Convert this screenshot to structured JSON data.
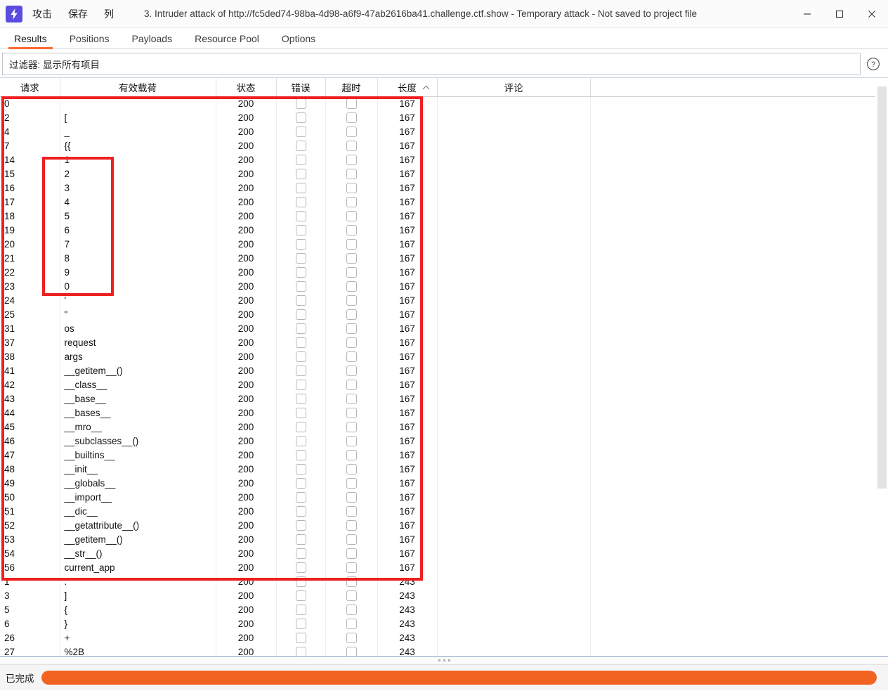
{
  "window": {
    "title": "3. Intruder attack of http://fc5ded74-98ba-4d98-a6f9-47ab2616ba41.challenge.ctf.show - Temporary attack - Not saved to project file",
    "logo_icon": "burp-lightning-icon",
    "minimize_icon": "minimize-icon",
    "maximize_icon": "maximize-icon",
    "close_icon": "close-icon"
  },
  "menu": {
    "attack": "攻击",
    "save": "保存",
    "columns": "列"
  },
  "tabs": [
    {
      "label": "Results",
      "active": true
    },
    {
      "label": "Positions",
      "active": false
    },
    {
      "label": "Payloads",
      "active": false
    },
    {
      "label": "Resource Pool",
      "active": false
    },
    {
      "label": "Options",
      "active": false
    }
  ],
  "filter": {
    "text": "过滤器: 显示所有项目",
    "help_icon": "question-mark-circle-icon"
  },
  "table": {
    "columns": [
      "请求",
      "有效载荷",
      "状态",
      "错误",
      "超时",
      "长度",
      "评论",
      ""
    ],
    "sort_column": "长度",
    "sort_direction": "ascending",
    "rows": [
      {
        "request": "0",
        "payload": "",
        "status": "200",
        "error": false,
        "timeout": false,
        "length": "167",
        "comment": ""
      },
      {
        "request": "2",
        "payload": "[",
        "status": "200",
        "error": false,
        "timeout": false,
        "length": "167",
        "comment": ""
      },
      {
        "request": "4",
        "payload": "_",
        "status": "200",
        "error": false,
        "timeout": false,
        "length": "167",
        "comment": ""
      },
      {
        "request": "7",
        "payload": "{{",
        "status": "200",
        "error": false,
        "timeout": false,
        "length": "167",
        "comment": ""
      },
      {
        "request": "14",
        "payload": "1",
        "status": "200",
        "error": false,
        "timeout": false,
        "length": "167",
        "comment": ""
      },
      {
        "request": "15",
        "payload": "2",
        "status": "200",
        "error": false,
        "timeout": false,
        "length": "167",
        "comment": ""
      },
      {
        "request": "16",
        "payload": "3",
        "status": "200",
        "error": false,
        "timeout": false,
        "length": "167",
        "comment": ""
      },
      {
        "request": "17",
        "payload": "4",
        "status": "200",
        "error": false,
        "timeout": false,
        "length": "167",
        "comment": ""
      },
      {
        "request": "18",
        "payload": "5",
        "status": "200",
        "error": false,
        "timeout": false,
        "length": "167",
        "comment": ""
      },
      {
        "request": "19",
        "payload": "6",
        "status": "200",
        "error": false,
        "timeout": false,
        "length": "167",
        "comment": ""
      },
      {
        "request": "20",
        "payload": "7",
        "status": "200",
        "error": false,
        "timeout": false,
        "length": "167",
        "comment": ""
      },
      {
        "request": "21",
        "payload": "8",
        "status": "200",
        "error": false,
        "timeout": false,
        "length": "167",
        "comment": ""
      },
      {
        "request": "22",
        "payload": "9",
        "status": "200",
        "error": false,
        "timeout": false,
        "length": "167",
        "comment": ""
      },
      {
        "request": "23",
        "payload": "0",
        "status": "200",
        "error": false,
        "timeout": false,
        "length": "167",
        "comment": ""
      },
      {
        "request": "24",
        "payload": "'",
        "status": "200",
        "error": false,
        "timeout": false,
        "length": "167",
        "comment": ""
      },
      {
        "request": "25",
        "payload": "\"",
        "status": "200",
        "error": false,
        "timeout": false,
        "length": "167",
        "comment": ""
      },
      {
        "request": "31",
        "payload": "os",
        "status": "200",
        "error": false,
        "timeout": false,
        "length": "167",
        "comment": ""
      },
      {
        "request": "37",
        "payload": "request",
        "status": "200",
        "error": false,
        "timeout": false,
        "length": "167",
        "comment": ""
      },
      {
        "request": "38",
        "payload": "args",
        "status": "200",
        "error": false,
        "timeout": false,
        "length": "167",
        "comment": ""
      },
      {
        "request": "41",
        "payload": "__getitem__()",
        "status": "200",
        "error": false,
        "timeout": false,
        "length": "167",
        "comment": ""
      },
      {
        "request": "42",
        "payload": "__class__",
        "status": "200",
        "error": false,
        "timeout": false,
        "length": "167",
        "comment": ""
      },
      {
        "request": "43",
        "payload": "__base__",
        "status": "200",
        "error": false,
        "timeout": false,
        "length": "167",
        "comment": ""
      },
      {
        "request": "44",
        "payload": "__bases__",
        "status": "200",
        "error": false,
        "timeout": false,
        "length": "167",
        "comment": ""
      },
      {
        "request": "45",
        "payload": "__mro__",
        "status": "200",
        "error": false,
        "timeout": false,
        "length": "167",
        "comment": ""
      },
      {
        "request": "46",
        "payload": "__subclasses__()",
        "status": "200",
        "error": false,
        "timeout": false,
        "length": "167",
        "comment": ""
      },
      {
        "request": "47",
        "payload": "__builtins__",
        "status": "200",
        "error": false,
        "timeout": false,
        "length": "167",
        "comment": ""
      },
      {
        "request": "48",
        "payload": "__init__",
        "status": "200",
        "error": false,
        "timeout": false,
        "length": "167",
        "comment": ""
      },
      {
        "request": "49",
        "payload": "__globals__",
        "status": "200",
        "error": false,
        "timeout": false,
        "length": "167",
        "comment": ""
      },
      {
        "request": "50",
        "payload": "__import__",
        "status": "200",
        "error": false,
        "timeout": false,
        "length": "167",
        "comment": ""
      },
      {
        "request": "51",
        "payload": "__dic__",
        "status": "200",
        "error": false,
        "timeout": false,
        "length": "167",
        "comment": ""
      },
      {
        "request": "52",
        "payload": "__getattribute__()",
        "status": "200",
        "error": false,
        "timeout": false,
        "length": "167",
        "comment": ""
      },
      {
        "request": "53",
        "payload": "__getitem__()",
        "status": "200",
        "error": false,
        "timeout": false,
        "length": "167",
        "comment": ""
      },
      {
        "request": "54",
        "payload": "__str__()",
        "status": "200",
        "error": false,
        "timeout": false,
        "length": "167",
        "comment": ""
      },
      {
        "request": "56",
        "payload": "current_app",
        "status": "200",
        "error": false,
        "timeout": false,
        "length": "167",
        "comment": ""
      },
      {
        "request": "1",
        "payload": ".",
        "status": "200",
        "error": false,
        "timeout": false,
        "length": "243",
        "comment": ""
      },
      {
        "request": "3",
        "payload": "]",
        "status": "200",
        "error": false,
        "timeout": false,
        "length": "243",
        "comment": ""
      },
      {
        "request": "5",
        "payload": "{",
        "status": "200",
        "error": false,
        "timeout": false,
        "length": "243",
        "comment": ""
      },
      {
        "request": "6",
        "payload": "}",
        "status": "200",
        "error": false,
        "timeout": false,
        "length": "243",
        "comment": ""
      },
      {
        "request": "26",
        "payload": "+",
        "status": "200",
        "error": false,
        "timeout": false,
        "length": "243",
        "comment": ""
      },
      {
        "request": "27",
        "payload": "%2B",
        "status": "200",
        "error": false,
        "timeout": false,
        "length": "243",
        "comment": ""
      }
    ]
  },
  "annotations": {
    "highlight_color": "#ef1f20",
    "outer_box_label": "results-167-length-group",
    "inner_box_label": "numeric-payload-group"
  },
  "status": {
    "label": "已完成",
    "progress_percent": 100,
    "progress_color": "#f26322"
  }
}
